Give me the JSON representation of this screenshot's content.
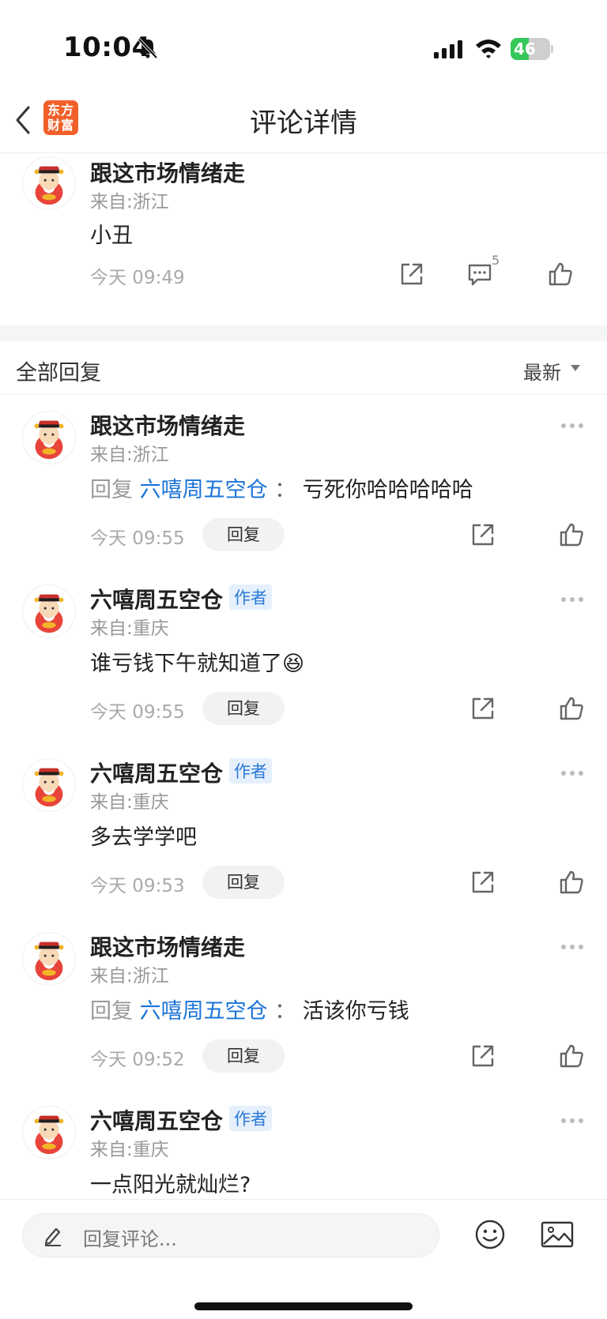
{
  "status_bar": {
    "time": "10:04",
    "battery": "46",
    "battery_level": 0.46
  },
  "nav": {
    "title": "评论详情",
    "logo_line1": "东方",
    "logo_line2": "财富"
  },
  "main_comment": {
    "username": "跟这市场情绪走",
    "location": "来自:浙江",
    "text": "小丑",
    "time": "今天 09:49",
    "comment_count": "5"
  },
  "replies_header": {
    "title": "全部回复",
    "sort": "最新"
  },
  "replies": [
    {
      "username": "跟这市场情绪走",
      "author_badge": "",
      "location": "来自:浙江",
      "reply_prefix": "回复",
      "reply_target": "六嘻周五空仓",
      "reply_sep": "：",
      "text": "亏死你哈哈哈哈哈",
      "time": "今天 09:55",
      "reply_label": "回复"
    },
    {
      "username": "六嘻周五空仓",
      "author_badge": "作者",
      "location": "来自:重庆",
      "reply_prefix": "",
      "reply_target": "",
      "reply_sep": "",
      "text": "谁亏钱下午就知道了😆",
      "time": "今天 09:55",
      "reply_label": "回复"
    },
    {
      "username": "六嘻周五空仓",
      "author_badge": "作者",
      "location": "来自:重庆",
      "reply_prefix": "",
      "reply_target": "",
      "reply_sep": "",
      "text": "多去学学吧",
      "time": "今天 09:53",
      "reply_label": "回复"
    },
    {
      "username": "跟这市场情绪走",
      "author_badge": "",
      "location": "来自:浙江",
      "reply_prefix": "回复",
      "reply_target": "六嘻周五空仓",
      "reply_sep": "：",
      "text": "活该你亏钱",
      "time": "今天 09:52",
      "reply_label": "回复"
    },
    {
      "username": "六嘻周五空仓",
      "author_badge": "作者",
      "location": "来自:重庆",
      "reply_prefix": "",
      "reply_target": "",
      "reply_sep": "",
      "text": "一点阳光就灿烂?",
      "time": "",
      "reply_label": ""
    }
  ],
  "bottom_bar": {
    "placeholder": "回复评论..."
  },
  "colors": {
    "brand": "#f2602a",
    "link": "#1a73d9",
    "author_badge_bg": "#e6f0fc",
    "battery_green": "#34c759"
  },
  "icons": [
    "back-icon",
    "share-icon",
    "comment-icon",
    "like-icon",
    "more-icon",
    "pencil-icon",
    "emoji-icon",
    "image-icon",
    "bell-muted-icon",
    "signal-icon",
    "wifi-icon"
  ]
}
